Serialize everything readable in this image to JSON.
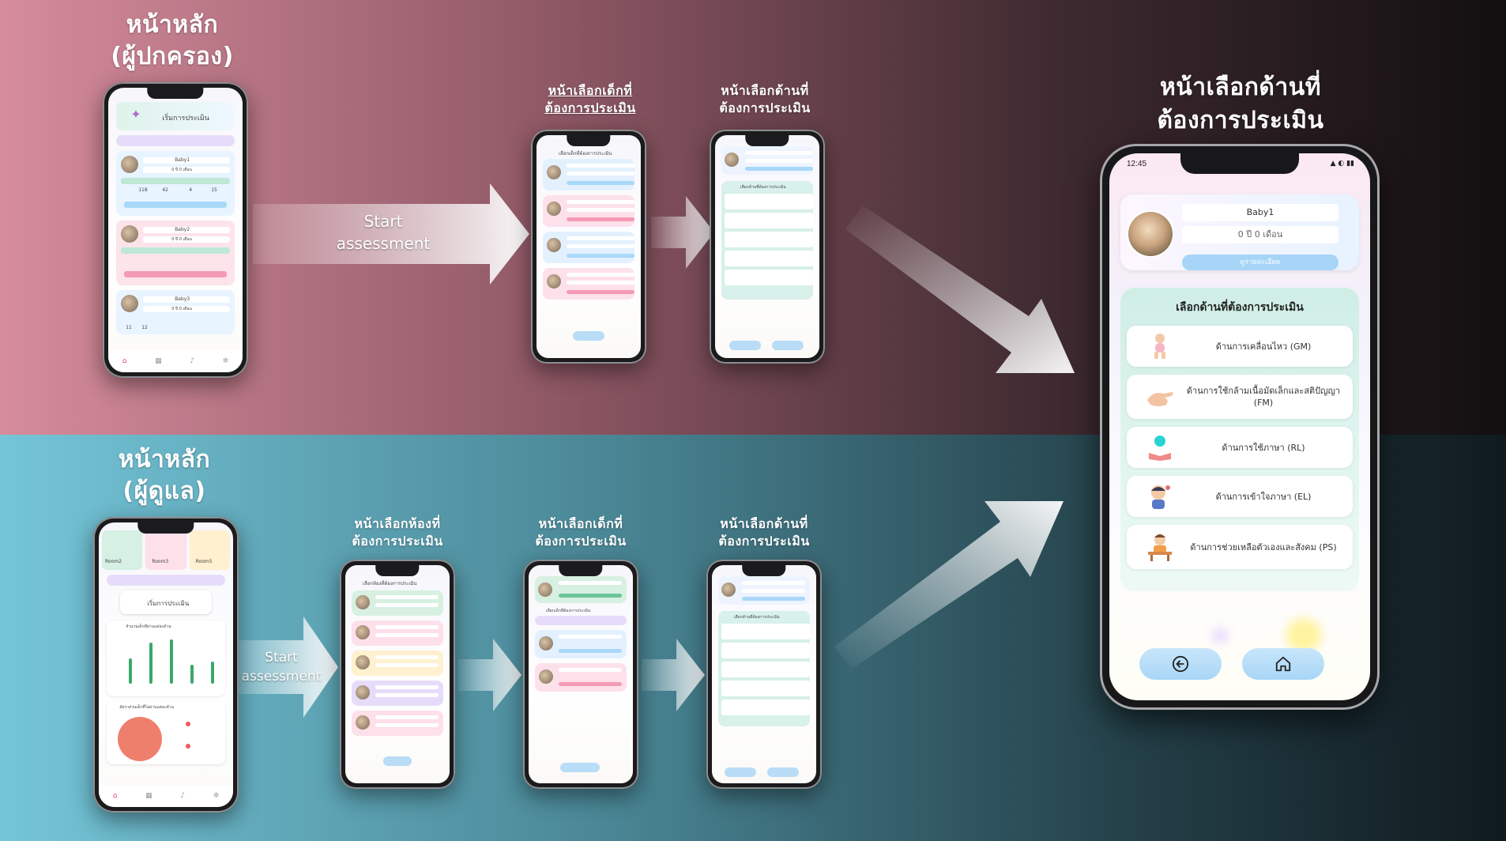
{
  "top_section": {
    "headings": {
      "parent_home": "หน้าหลัก\n(ผู้ปกครอง)",
      "select_child": "หน้าเลือกเด็กที่\nต้องการประเมิน",
      "select_domain": "หน้าเลือกด้านที่\nต้องการประเมิน",
      "large_select_domain": "หน้าเลือกด้านที่\nต้องการประเมิน"
    },
    "arrow_label": "Start\nassessment"
  },
  "bottom_section": {
    "headings": {
      "caregiver_home": "หน้าหลัก\n(ผู้ดูแล)",
      "select_room": "หน้าเลือกห้องที่\nต้องการประเมิน",
      "select_child": "หน้าเลือกเด็กที่\nต้องการประเมิน",
      "select_domain": "หน้าเลือกด้านที่\nต้องการประเมิน"
    },
    "arrow_label": "Start\nassessment"
  },
  "large_phone": {
    "status_time": "12:45",
    "child": {
      "name": "Baby1",
      "age": "0 ปี 0 เดือน",
      "detail_button": "ดูรายละเอียด"
    },
    "panel_title": "เลือกด้านที่ต้องการประเมิน",
    "domains": [
      {
        "label": "ด้านการเคลื่อนไหว (GM)",
        "icon": "baby-crawl-icon"
      },
      {
        "label": "ด้านการใช้กล้ามเนื้อมัดเล็กและสติปัญญา (FM)",
        "icon": "hand-icon"
      },
      {
        "label": "ด้านการใช้ภาษา (RL)",
        "icon": "book-icon"
      },
      {
        "label": "ด้านการเข้าใจภาษา (EL)",
        "icon": "child-thinking-icon"
      },
      {
        "label": "ด้านการช่วยเหลือตัวเองและสังคม (PS)",
        "icon": "child-eating-icon"
      }
    ],
    "nav": {
      "back": "back-arrow-icon",
      "home": "home-icon"
    }
  },
  "mini_screens": {
    "parent_home": {
      "start_button": "เริ่มการประเมิน",
      "children": [
        {
          "name": "Baby1",
          "age": "0 ปี 0 เดือน",
          "scores": [
            "118",
            "42",
            "4",
            "15"
          ]
        },
        {
          "name": "Baby2",
          "age": "0 ปี 0 เดือน",
          "scores": [
            "",
            "",
            "",
            ""
          ]
        },
        {
          "name": "Baby3",
          "age": "0 ปี 0 เดือน",
          "scores": [
            "11",
            "12"
          ]
        }
      ]
    },
    "select_child_title": "เลือกเด็กที่ต้องการประเมิน",
    "select_room_title": "เลือกห้องที่ต้องการประเมิน",
    "select_domain_title": "เลือกด้านที่ต้องการประเมิน",
    "caregiver_home": {
      "start_button": "เริ่มการประเมิน",
      "chart_title": "จำนวนเด็กที่ผ่านแต่ละด้าน",
      "pie_title": "อัตราส่วนเด็กที่ไม่ผ่านแต่ละด้าน",
      "rooms": [
        "Room2",
        "Room3",
        "Room5"
      ]
    }
  }
}
